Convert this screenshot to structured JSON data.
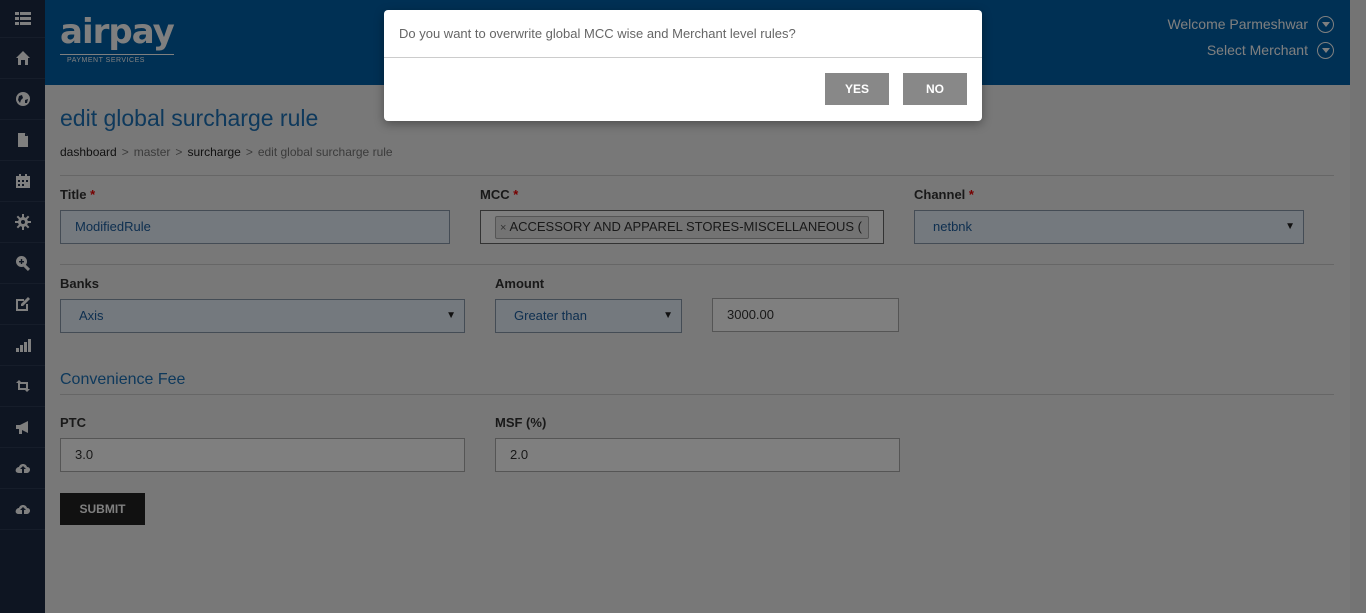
{
  "sidebar": {
    "items": [
      {
        "icon": "grid-menu-icon"
      },
      {
        "icon": "home-icon"
      },
      {
        "icon": "globe-icon"
      },
      {
        "icon": "document-icon"
      },
      {
        "icon": "calendar-icon"
      },
      {
        "icon": "gear-icon"
      },
      {
        "icon": "zoom-in-icon"
      },
      {
        "icon": "edit-icon"
      },
      {
        "icon": "bar-chart-icon"
      },
      {
        "icon": "retweet-icon"
      },
      {
        "icon": "megaphone-icon"
      },
      {
        "icon": "cloud-upload-icon"
      },
      {
        "icon": "cloud-upload-icon"
      }
    ]
  },
  "header": {
    "logo_text": "airpay",
    "logo_sub": "PAYMENT SERVICES",
    "welcome": "Welcome Parmeshwar",
    "select_merchant": "Select Merchant"
  },
  "page": {
    "title": "edit global surcharge rule",
    "breadcrumb": [
      "dashboard",
      "master",
      "surcharge",
      "edit global surcharge rule"
    ]
  },
  "form": {
    "title_label": "Title",
    "title_value": "ModifiedRule",
    "mcc_label": "MCC",
    "mcc_tag": "ACCESSORY AND APPAREL STORES-MISCELLANEOUS (",
    "channel_label": "Channel",
    "channel_value": "netbnk",
    "banks_label": "Banks",
    "banks_value": "Axis",
    "amount_label": "Amount",
    "amount_operator": "Greater than",
    "amount_value": "3000.00",
    "fee_section": "Convenience Fee",
    "ptc_label": "PTC",
    "ptc_value": "3.0",
    "msf_label": "MSF (%)",
    "msf_value": "2.0",
    "submit_label": "SUBMIT"
  },
  "modal": {
    "message": "Do you want to overwrite global MCC wise and Merchant level rules?",
    "yes_label": "YES",
    "no_label": "NO"
  },
  "colors": {
    "header": "#0060a9",
    "sidebar": "#1d2b44",
    "accent": "#1d72b8"
  }
}
